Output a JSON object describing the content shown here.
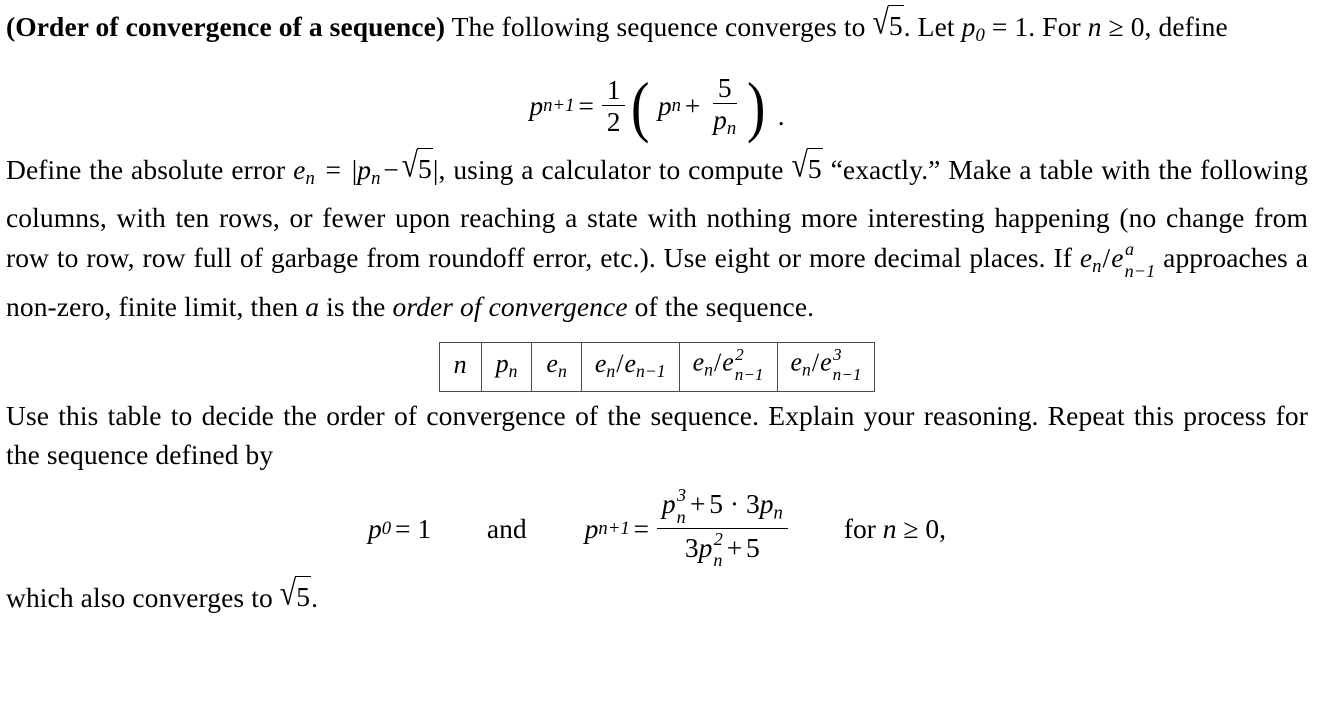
{
  "document": {
    "title_bold": "(Order of convergence of a sequence)",
    "paragraph1": {
      "text_a": "The following sequence converges to",
      "sqrt_value": "5",
      "text_b": ". Let",
      "line2_a": "= 1. For",
      "line2_var": "n",
      "line2_rel": "≥ 0, define",
      "p_symbol": "p",
      "p_sub": "0"
    },
    "equation1": {
      "lhs_var": "p",
      "lhs_sub": "n+1",
      "equals": "=",
      "frac_num": "1",
      "frac_den": "2",
      "paren_open": "(",
      "inner_var": "p",
      "inner_sub": "n",
      "plus": "+",
      "inner_frac_num": "5",
      "inner_frac_den_var": "p",
      "inner_frac_den_sub": "n",
      "paren_close": ")",
      "period": "."
    },
    "paragraph2": {
      "s1": "Define the absolute error",
      "e_var": "e",
      "e_sub": "n",
      "eq": "=",
      "abs_open": "|",
      "p_var": "p",
      "p_sub": "n",
      "minus": "−",
      "sqrt_value": "5",
      "abs_close": "|",
      "s2": ", using a calculator to compute",
      "s3": "“exactly.” Make a table with the following columns, with ten rows, or fewer upon reaching a state with nothing more interesting happening (no change from row to row, row full of garbage from roundoff error, etc.). Use eight or more decimal places. If",
      "ratio_num_var": "e",
      "ratio_num_sub": "n",
      "ratio_slash": "/",
      "ratio_den_var": "e",
      "ratio_den_sup": "a",
      "ratio_den_sub": "n−1",
      "s4": "approaches a non-zero, finite limit, then",
      "a_var": "a",
      "s5": "is the",
      "italic_phrase": "order of convergence",
      "s6": "of the sequence."
    },
    "table": {
      "columns": [
        {
          "id": "n",
          "var": "n",
          "sub": "",
          "type": "plain"
        },
        {
          "id": "p_n",
          "var": "p",
          "sub": "n",
          "type": "sub"
        },
        {
          "id": "e_n",
          "var": "e",
          "sub": "n",
          "type": "sub"
        },
        {
          "id": "e_ratio1",
          "label": "e_n/e_{n-1}",
          "type": "ratio",
          "power": ""
        },
        {
          "id": "e_ratio2",
          "label": "e_n/e^2_{n-1}",
          "type": "ratio",
          "power": "2"
        },
        {
          "id": "e_ratio3",
          "label": "e_n/e^3_{n-1}",
          "type": "ratio",
          "power": "3"
        }
      ],
      "col1_text": "n",
      "col2_var": "p",
      "col2_sub": "n",
      "col3_var": "e",
      "col3_sub": "n",
      "num_var": "e",
      "num_sub": "n",
      "slash": "/",
      "den_var": "e",
      "den_sub": "n−1",
      "pow2": "2",
      "pow3": "3",
      "rows": []
    },
    "paragraph3": {
      "text": "Use this table to decide the order of convergence of the sequence. Explain your reasoning. Repeat this process for the sequence defined by"
    },
    "equation2": {
      "p0_var": "p",
      "p0_sub": "0",
      "p0_eq": "= 1",
      "and_word": "and",
      "lhs_var": "p",
      "lhs_sub": "n+1",
      "equals": "=",
      "num_var": "p",
      "num_sub": "n",
      "num_sup": "3",
      "num_plus": "+",
      "num_rest": "5 · 3",
      "num_tail_var": "p",
      "num_tail_sub": "n",
      "den_lead": "3",
      "den_var": "p",
      "den_sub": "n",
      "den_sup": "2",
      "den_plus": "+",
      "den_tail": "5",
      "condition_pre": "for",
      "condition_var": "n",
      "condition_post": "≥ 0,"
    },
    "closing": {
      "text_a": "which also converges to",
      "sqrt_value": "5",
      "text_b": "."
    }
  },
  "colors": {
    "background": "#ffffff",
    "text": "#000000",
    "table_border": "#3a3a3a"
  }
}
